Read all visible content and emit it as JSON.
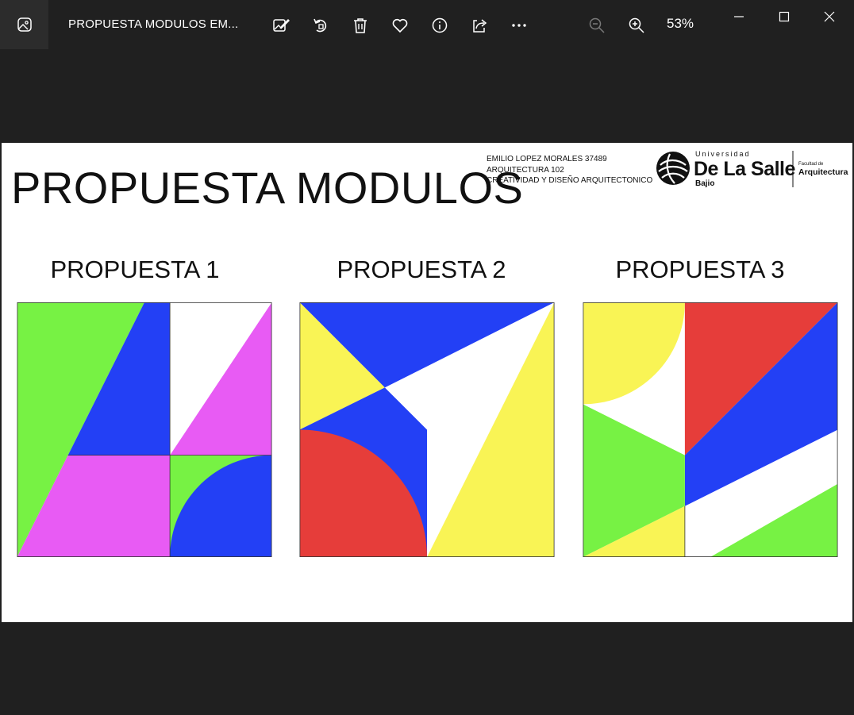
{
  "window": {
    "file_title": "PROPUESTA MODULOS EM...",
    "zoom": "53%"
  },
  "toolbar": {
    "icons": [
      "edit-image-icon",
      "rotate-icon",
      "delete-icon",
      "favorite-icon",
      "info-icon",
      "share-icon",
      "more-icon",
      "zoom-out-icon",
      "zoom-in-icon"
    ]
  },
  "slide": {
    "title": "PROPUESTA MODULOS",
    "author_lines": [
      "EMILIO LOPEZ MORALES 37489",
      "ARQUITECTURA 102",
      "CREATIVIDAD Y DISEÑO ARQUITECTONICO"
    ],
    "logo": {
      "universidad": "Universidad",
      "name": "De La Salle",
      "campus": "Bajio",
      "faculty_small": "Facultad de",
      "faculty": "Arquitectura"
    },
    "proposals": [
      "PROPUESTA 1",
      "PROPUESTA 2",
      "PROPUESTA 3"
    ]
  },
  "colors": {
    "green": "#77f244",
    "blue": "#2340f5",
    "magenta": "#e85bf4",
    "yellow": "#f9f455",
    "red": "#e63d3a",
    "white": "#ffffff"
  }
}
